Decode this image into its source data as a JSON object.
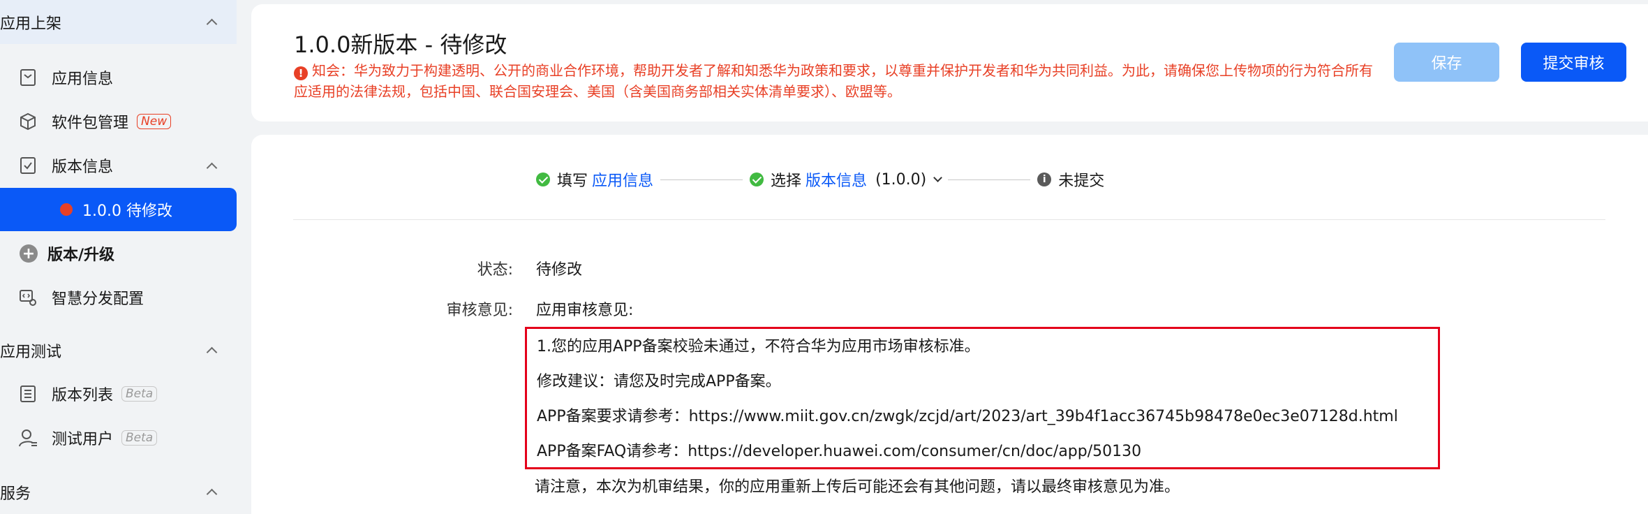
{
  "sidebar": {
    "group_publish": "应用上架",
    "app_info": "应用信息",
    "package_mgmt": "软件包管理",
    "badge_new": "New",
    "version_info": "版本信息",
    "active_version": "1.0.0 待修改",
    "version_upgrade": "版本/升级",
    "smart_distribution": "智慧分发配置",
    "group_testing": "应用测试",
    "version_list": "版本列表",
    "test_users": "测试用户",
    "badge_beta": "Beta",
    "group_service": "服务"
  },
  "header": {
    "title": "1.0.0新版本 - 待修改",
    "notice_icon": "!",
    "notice": "知会：华为致力于构建透明、公开的商业合作环境，帮助开发者了解和知悉华为政策和要求，以尊重并保护开发者和华为共同利益。为此，请确保您上传物项的行为符合所有应适用的法律法规，包括中国、联合国安理会、美国（含美国商务部相关实体清单要求）、欧盟等。",
    "save_label": "保存",
    "submit_label": "提交审核"
  },
  "steps": {
    "s1_prefix": "填写",
    "s1_link": "应用信息",
    "s2_prefix": "选择",
    "s2_link": "版本信息",
    "s2_version": "(1.0.0)",
    "s3_label": "未提交",
    "info_glyph": "i"
  },
  "details": {
    "status_label": "状态:",
    "status_value": "待修改",
    "review_label": "审核意见:",
    "review_heading": "应用审核意见:",
    "review_lines": [
      "1.您的应用APP备案校验未通过，不符合华为应用市场审核标准。",
      "修改建议：请您及时完成APP备案。",
      "APP备案要求请参考：https://www.miit.gov.cn/zwgk/zcjd/art/2023/art_39b4f1acc36745b98478e0ec3e07128d.html",
      "APP备案FAQ请参考：https://developer.huawei.com/consumer/cn/doc/app/50130"
    ],
    "footnote": "请注意，本次为机审结果，你的应用重新上传后可能还会有其他问题，请以最终审核意见为准。"
  }
}
